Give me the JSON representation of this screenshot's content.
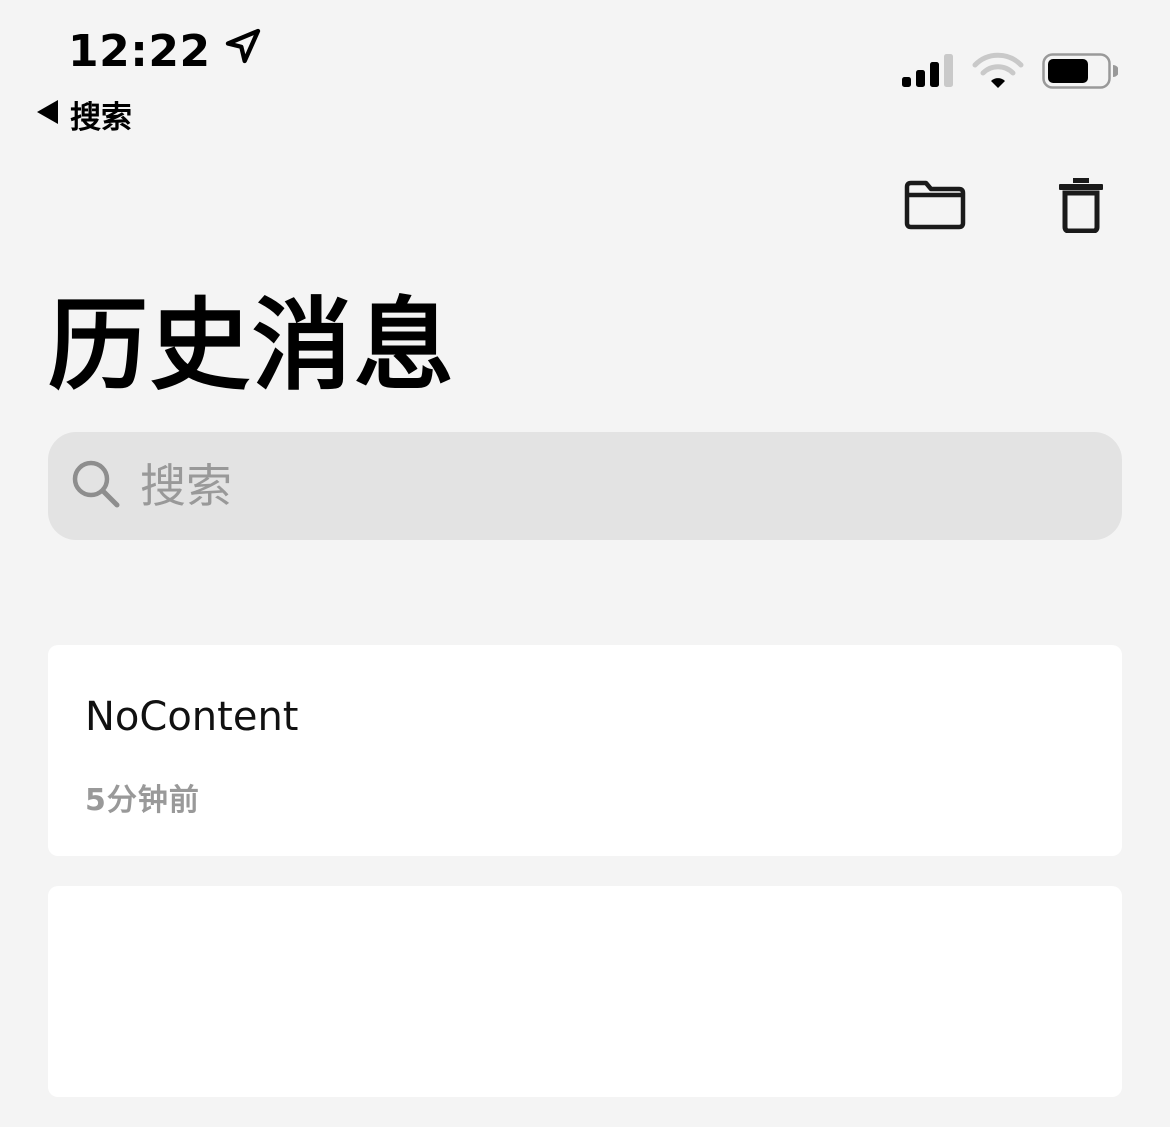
{
  "status_bar": {
    "time": "12:22",
    "back_label": "搜索"
  },
  "toolbar": {
    "folder_icon": "folder-icon",
    "trash_icon": "trash-icon"
  },
  "page": {
    "title": "历史消息"
  },
  "search": {
    "placeholder": "搜索",
    "value": ""
  },
  "history": [
    {
      "title": "NoContent",
      "time": "5分钟前"
    },
    {
      "title": "",
      "time": ""
    }
  ],
  "colors": {
    "background": "#f4f4f4",
    "search_bg": "#e3e3e3",
    "card_bg": "#ffffff",
    "secondary_text": "#999999"
  }
}
